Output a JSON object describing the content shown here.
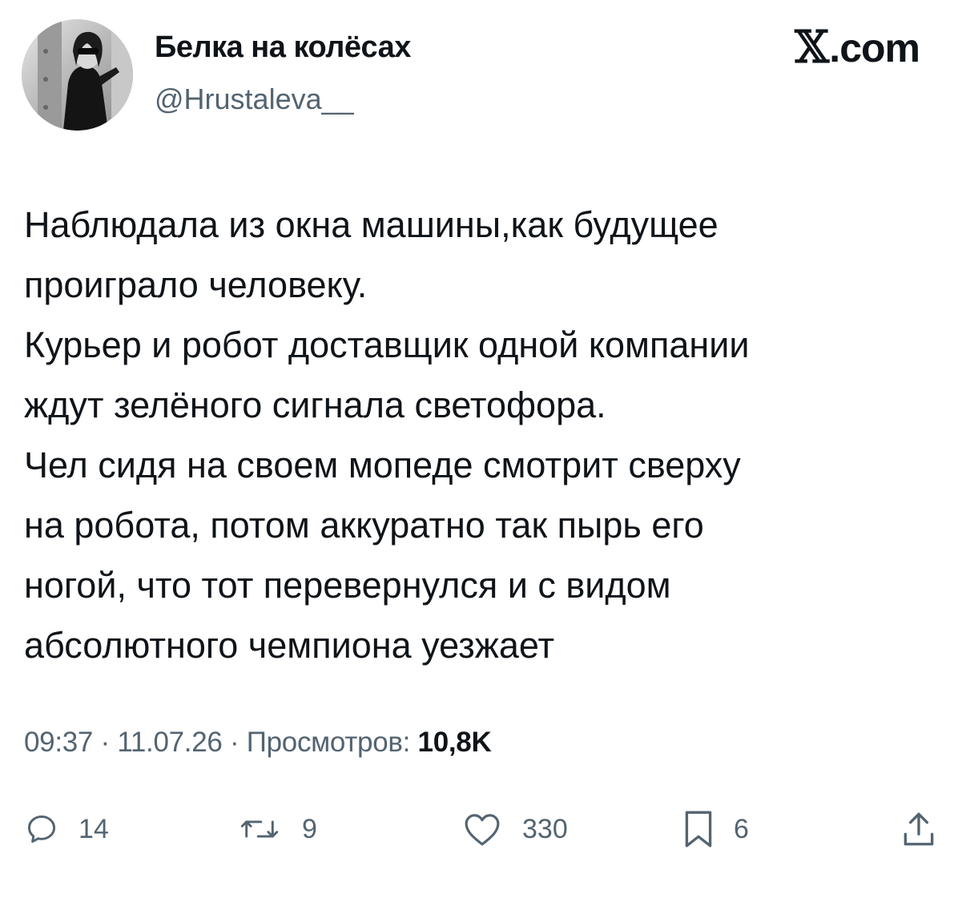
{
  "author": {
    "name": "Белка на колёсах",
    "handle": "@Hrustaleva__"
  },
  "brand": {
    "x": "𝕏",
    "domain": ".com"
  },
  "tweet": {
    "lines": [
      "Наблюдала из окна машины,как будущее",
      "проиграло человеку.",
      "Курьер и робот доставщик одной компании",
      "ждут зелёного сигнала светофора.",
      "Чел сидя на своем мопеде смотрит сверху",
      "на робота, потом аккуратно так пырь его",
      "ногой, что тот перевернулся и с видом",
      "абсолютного чемпиона уезжает"
    ]
  },
  "meta": {
    "time": "09:37",
    "sep1": " · ",
    "date": "11.07.26",
    "sep2": " · ",
    "views_label": "Просмотров: ",
    "views_count": "10,8K"
  },
  "actions": {
    "replies": {
      "icon": "reply-icon",
      "count": "14"
    },
    "reposts": {
      "icon": "repost-icon",
      "count": "9"
    },
    "likes": {
      "icon": "heart-icon",
      "count": "330"
    },
    "bookmarks": {
      "icon": "bookmark-icon",
      "count": "6"
    },
    "share": {
      "icon": "share-icon"
    }
  },
  "colors": {
    "text": "#0f1419",
    "secondary": "#536471",
    "background": "#ffffff"
  }
}
